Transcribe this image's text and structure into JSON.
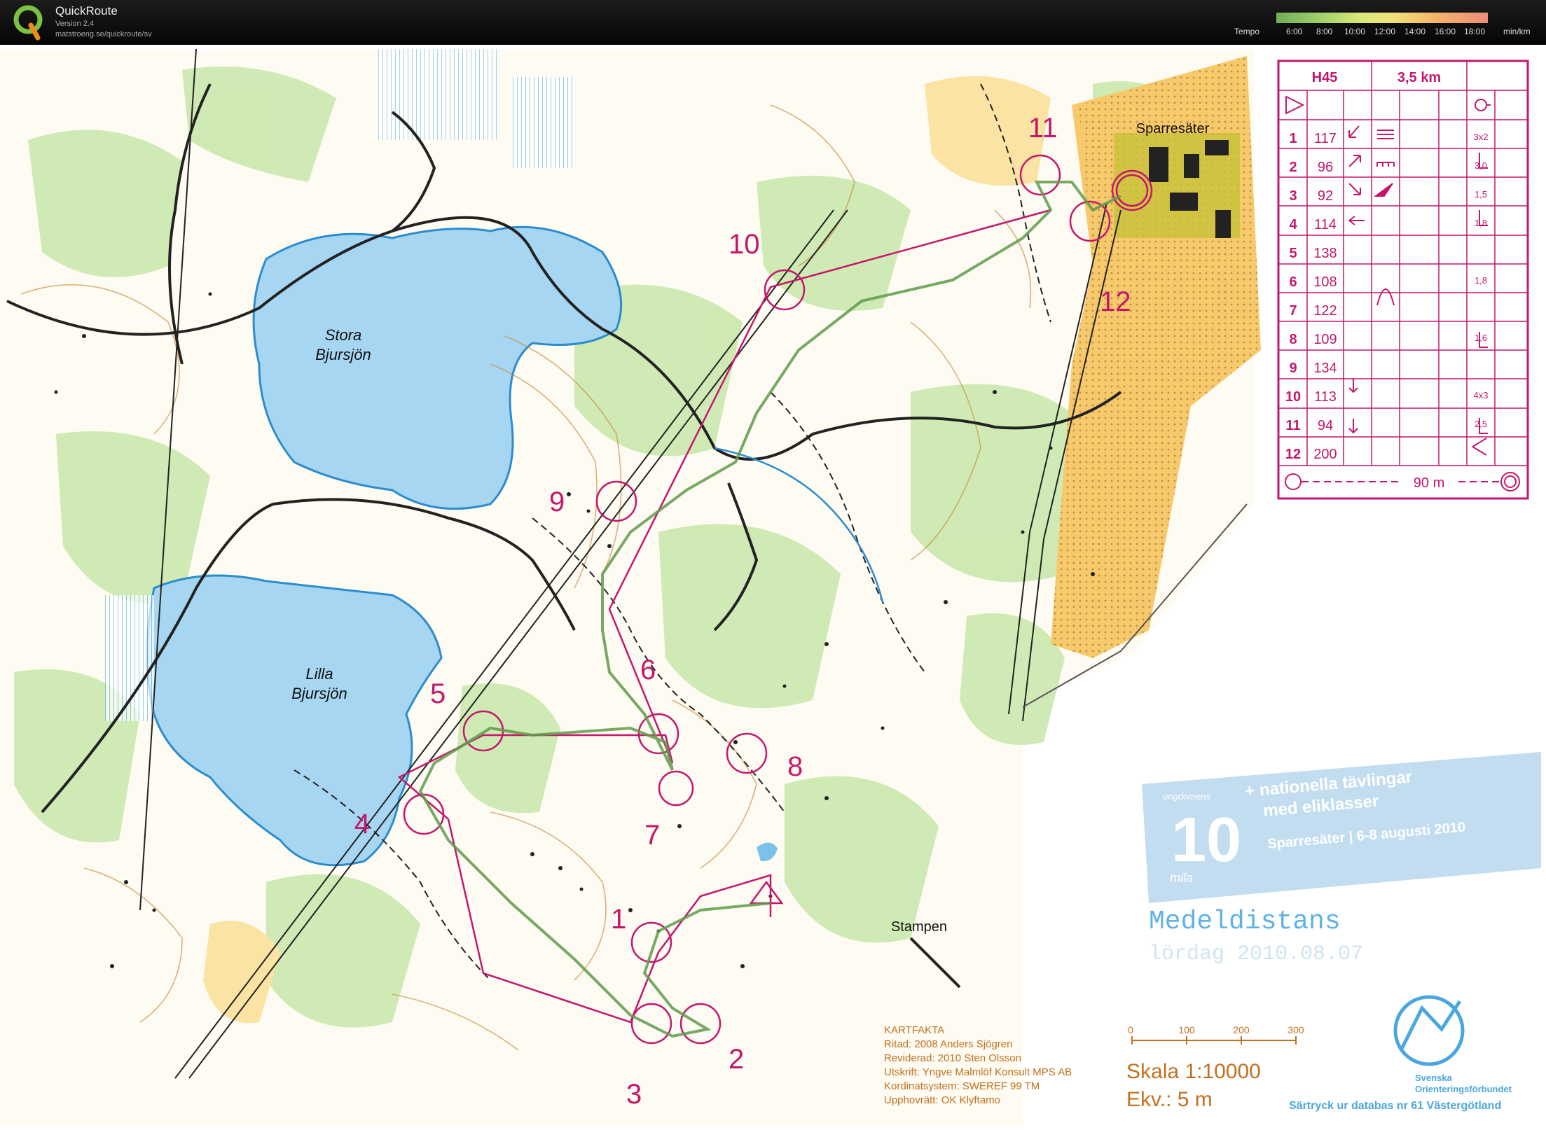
{
  "app": {
    "title": "QuickRoute",
    "version": "Version 2.4",
    "url": "matstroeng.se/quickroute/sv"
  },
  "tempo": {
    "label": "Tempo",
    "ticks": [
      "6:00",
      "8:00",
      "10:00",
      "12:00",
      "14:00",
      "16:00",
      "18:00"
    ],
    "unit": "min/km",
    "colors": [
      "#6fae5b",
      "#9fcf6a",
      "#d9e87a",
      "#f2e07a",
      "#f3b56a",
      "#ec8c7a"
    ]
  },
  "map": {
    "lakes": [
      "Stora Bjursjön",
      "Lilla Bjursjön"
    ],
    "lake_line1": [
      "Stora",
      "Lilla"
    ],
    "lake_line2": [
      "Bjursjön",
      "Bjursjön"
    ],
    "places": [
      "Sparresäter",
      "Stampen"
    ],
    "control_numbers": [
      "1",
      "2",
      "3",
      "4",
      "5",
      "6",
      "7",
      "8",
      "9",
      "10",
      "11",
      "12"
    ]
  },
  "course": {
    "class": "H45",
    "length": "3,5 km",
    "controls": [
      {
        "n": "1",
        "code": "117",
        "extra": "3x2"
      },
      {
        "n": "2",
        "code": "96",
        "extra": "3,0"
      },
      {
        "n": "3",
        "code": "92",
        "extra": "1,5"
      },
      {
        "n": "4",
        "code": "114",
        "extra": "1,8"
      },
      {
        "n": "5",
        "code": "138",
        "extra": ""
      },
      {
        "n": "6",
        "code": "108",
        "extra": "1,8"
      },
      {
        "n": "7",
        "code": "122",
        "extra": ""
      },
      {
        "n": "8",
        "code": "109",
        "extra": "1,6"
      },
      {
        "n": "9",
        "code": "134",
        "extra": ""
      },
      {
        "n": "10",
        "code": "113",
        "extra": "4x3"
      },
      {
        "n": "11",
        "code": "94",
        "extra": "2,5"
      },
      {
        "n": "12",
        "code": "200",
        "extra": ""
      }
    ],
    "finish": "90 m"
  },
  "event": {
    "banner_line1": "+ nationella tävlingar",
    "banner_line2": "med eliklasser",
    "banner_line3": "Sparresäter | 6-8 augusti 2010",
    "logo_text": "ungdomens",
    "logo_text2": "mila",
    "title": "Medeldistans",
    "date": "lördag 2010.08.07"
  },
  "kartfakta": {
    "heading": "KARTFAKTA",
    "lines": [
      "Ritad: 2008 Anders Sjögren",
      "Reviderad: 2010 Sten Olsson",
      "Utskrift: Yngve Malmlöf Konsult MPS AB",
      "Kordinatsystem: SWEREF 99 TM",
      "Upphovrätt: OK Klyftamo"
    ]
  },
  "scale": {
    "ticks": [
      "0",
      "100",
      "200",
      "300"
    ],
    "scale_text": "Skala 1:10000",
    "ekv_text": "Ekv.: 5 m"
  },
  "federation": {
    "name1": "Svenska",
    "name2": "Orienteringsförbundet",
    "reprint": "Särtryck ur databas nr 61 Västergötland"
  }
}
